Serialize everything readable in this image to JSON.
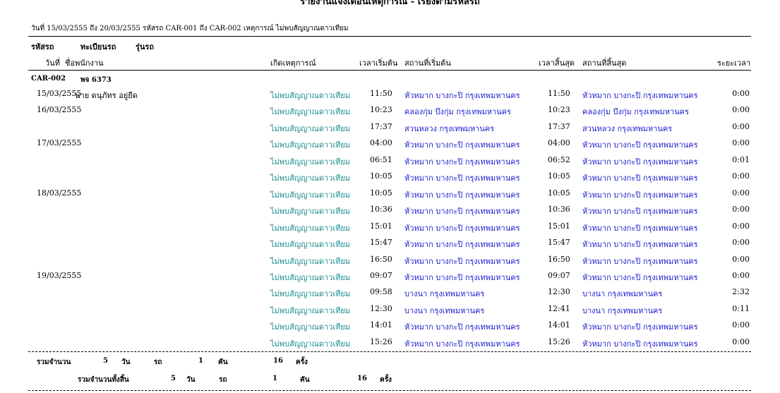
{
  "report": {
    "title": "รายงานแจ้งเตือนเหตุการณ์ - เรียงตามรหัสรถ",
    "criteria": "วันที่ 15/03/2555 ถึง 20/03/2555 รหัสรถ CAR-001 ถึง CAR-002 เหตุการณ์ ไม่พบสัญญาณดาวเทียม"
  },
  "headers": {
    "car_code": "รหัสรถ",
    "registration": "ทะเบียนรถ",
    "model": "รุ่นรถ",
    "date": "วันที่",
    "employee": "ชื่อพนักงาน",
    "event": "เกิดเหตุการณ์",
    "start_time": "เวลาเริ่มต้น",
    "start_place": "สถานที่เริ่มต้น",
    "end_time": "เวลาสิ้นสุด",
    "end_place": "สถานที่สิ้นสุด",
    "duration": "ระยะเวลา"
  },
  "group": {
    "car_code": "CAR-002",
    "registration": "พจ 6373"
  },
  "rows": [
    {
      "date": "15/03/2555",
      "employee": "นาย ดนุภัทร อยู่ยืด",
      "event": "ไม่พบสัญญาณดาวเทียม",
      "start_time": "11:50",
      "start_place": "หัวหมาก บางกะปิ กรุงเทพมหานคร",
      "end_time": "11:50",
      "end_place": "หัวหมาก บางกะปิ กรุงเทพมหานคร",
      "duration": "0:00"
    },
    {
      "date": "16/03/2555",
      "employee": "",
      "event": "ไม่พบสัญญาณดาวเทียม",
      "start_time": "10:23",
      "start_place": "คลองกุ่ม บึงกุ่ม กรุงเทพมหานคร",
      "end_time": "10:23",
      "end_place": "คลองกุ่ม บึงกุ่ม กรุงเทพมหานคร",
      "duration": "0:00"
    },
    {
      "date": "",
      "employee": "",
      "event": "ไม่พบสัญญาณดาวเทียม",
      "start_time": "17:37",
      "start_place": "สวนหลวง กรุงเทพมหานคร",
      "end_time": "17:37",
      "end_place": "สวนหลวง กรุงเทพมหานคร",
      "duration": "0:00"
    },
    {
      "date": "17/03/2555",
      "employee": "",
      "event": "ไม่พบสัญญาณดาวเทียม",
      "start_time": "04:00",
      "start_place": "หัวหมาก บางกะปิ กรุงเทพมหานคร",
      "end_time": "04:00",
      "end_place": "หัวหมาก บางกะปิ กรุงเทพมหานคร",
      "duration": "0:00"
    },
    {
      "date": "",
      "employee": "",
      "event": "ไม่พบสัญญาณดาวเทียม",
      "start_time": "06:51",
      "start_place": "หัวหมาก บางกะปิ กรุงเทพมหานคร",
      "end_time": "06:52",
      "end_place": "หัวหมาก บางกะปิ กรุงเทพมหานคร",
      "duration": "0:01"
    },
    {
      "date": "",
      "employee": "",
      "event": "ไม่พบสัญญาณดาวเทียม",
      "start_time": "10:05",
      "start_place": "หัวหมาก บางกะปิ กรุงเทพมหานคร",
      "end_time": "10:05",
      "end_place": "หัวหมาก บางกะปิ กรุงเทพมหานคร",
      "duration": "0:00"
    },
    {
      "date": "18/03/2555",
      "employee": "",
      "event": "ไม่พบสัญญาณดาวเทียม",
      "start_time": "10:05",
      "start_place": "หัวหมาก บางกะปิ กรุงเทพมหานคร",
      "end_time": "10:05",
      "end_place": "หัวหมาก บางกะปิ กรุงเทพมหานคร",
      "duration": "0:00"
    },
    {
      "date": "",
      "employee": "",
      "event": "ไม่พบสัญญาณดาวเทียม",
      "start_time": "10:36",
      "start_place": "หัวหมาก บางกะปิ กรุงเทพมหานคร",
      "end_time": "10:36",
      "end_place": "หัวหมาก บางกะปิ กรุงเทพมหานคร",
      "duration": "0:00"
    },
    {
      "date": "",
      "employee": "",
      "event": "ไม่พบสัญญาณดาวเทียม",
      "start_time": "15:01",
      "start_place": "หัวหมาก บางกะปิ กรุงเทพมหานคร",
      "end_time": "15:01",
      "end_place": "หัวหมาก บางกะปิ กรุงเทพมหานคร",
      "duration": "0:00"
    },
    {
      "date": "",
      "employee": "",
      "event": "ไม่พบสัญญาณดาวเทียม",
      "start_time": "15:47",
      "start_place": "หัวหมาก บางกะปิ กรุงเทพมหานคร",
      "end_time": "15:47",
      "end_place": "หัวหมาก บางกะปิ กรุงเทพมหานคร",
      "duration": "0:00"
    },
    {
      "date": "",
      "employee": "",
      "event": "ไม่พบสัญญาณดาวเทียม",
      "start_time": "16:50",
      "start_place": "หัวหมาก บางกะปิ กรุงเทพมหานคร",
      "end_time": "16:50",
      "end_place": "หัวหมาก บางกะปิ กรุงเทพมหานคร",
      "duration": "0:00"
    },
    {
      "date": "19/03/2555",
      "employee": "",
      "event": "ไม่พบสัญญาณดาวเทียม",
      "start_time": "09:07",
      "start_place": "หัวหมาก บางกะปิ กรุงเทพมหานคร",
      "end_time": "09:07",
      "end_place": "หัวหมาก บางกะปิ กรุงเทพมหานคร",
      "duration": "0:00"
    },
    {
      "date": "",
      "employee": "",
      "event": "ไม่พบสัญญาณดาวเทียม",
      "start_time": "09:58",
      "start_place": "บางนา กรุงเทพมหานคร",
      "end_time": "12:30",
      "end_place": "บางนา กรุงเทพมหานคร",
      "duration": "2:32"
    },
    {
      "date": "",
      "employee": "",
      "event": "ไม่พบสัญญาณดาวเทียม",
      "start_time": "12:30",
      "start_place": "บางนา กรุงเทพมหานคร",
      "end_time": "12:41",
      "end_place": "บางนา กรุงเทพมหานคร",
      "duration": "0:11"
    },
    {
      "date": "",
      "employee": "",
      "event": "ไม่พบสัญญาณดาวเทียม",
      "start_time": "14:01",
      "start_place": "หัวหมาก บางกะปิ กรุงเทพมหานคร",
      "end_time": "14:01",
      "end_place": "หัวหมาก บางกะปิ กรุงเทพมหานคร",
      "duration": "0:00"
    },
    {
      "date": "",
      "employee": "",
      "event": "ไม่พบสัญญาณดาวเทียม",
      "start_time": "15:26",
      "start_place": "หัวหมาก บางกะปิ กรุงเทพมหานคร",
      "end_time": "15:26",
      "end_place": "หัวหมาก บางกะปิ กรุงเทพมหานคร",
      "duration": "0:00"
    }
  ],
  "subtotal": {
    "label": "รวมจำนวน",
    "days": "5",
    "days_unit": "วัน",
    "cars_label": "รถ",
    "cars": "1",
    "cars_unit": "คัน",
    "times": "16",
    "times_unit": "ครั้ง"
  },
  "grand_total": {
    "label": "รวมจำนวนทั้งสิ้น",
    "days": "5",
    "days_unit": "วัน",
    "cars_label": "รถ",
    "cars": "1",
    "cars_unit": "คัน",
    "times": "16",
    "times_unit": "ครั้ง"
  }
}
